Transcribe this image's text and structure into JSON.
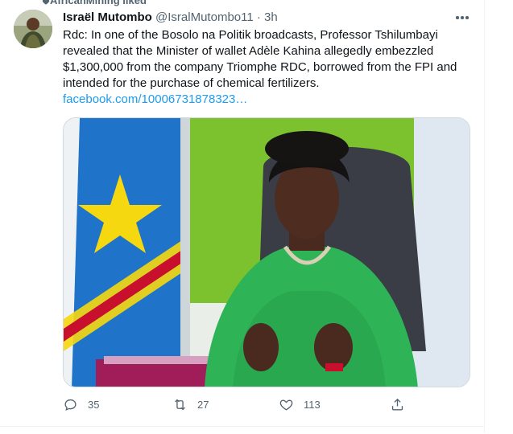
{
  "social_context": {
    "label": "AfricanMining liked"
  },
  "tweet": {
    "author_name": "Israël Mutombo",
    "handle": "@IsralMutombo11",
    "separator": "·",
    "time": "3h",
    "text": "Rdc: In one of the Bosolo na Politik broadcasts, Professor Tshilumbayi revealed that the Minister of wallet Adèle Kahina allegedly embezzled $1,300,000 from the company Triomphe RDC, borrowed from the FPI and intended for the purchase of chemical fertilizers.",
    "link": "facebook.com/10006731878323…"
  },
  "actions": {
    "replies": "35",
    "retweets": "27",
    "likes": "113"
  },
  "colors": {
    "link": "#1d9bf0",
    "secondary_text": "#536471",
    "flag_blue": "#1f74c9",
    "flag_star": "#f5d80f",
    "flag_red": "#c8102e",
    "dress_green": "#2eb456",
    "wall_green": "#7cc22e"
  },
  "icons": [
    "heart-icon",
    "more-icon",
    "reply-icon",
    "retweet-icon",
    "like-icon",
    "share-icon"
  ]
}
